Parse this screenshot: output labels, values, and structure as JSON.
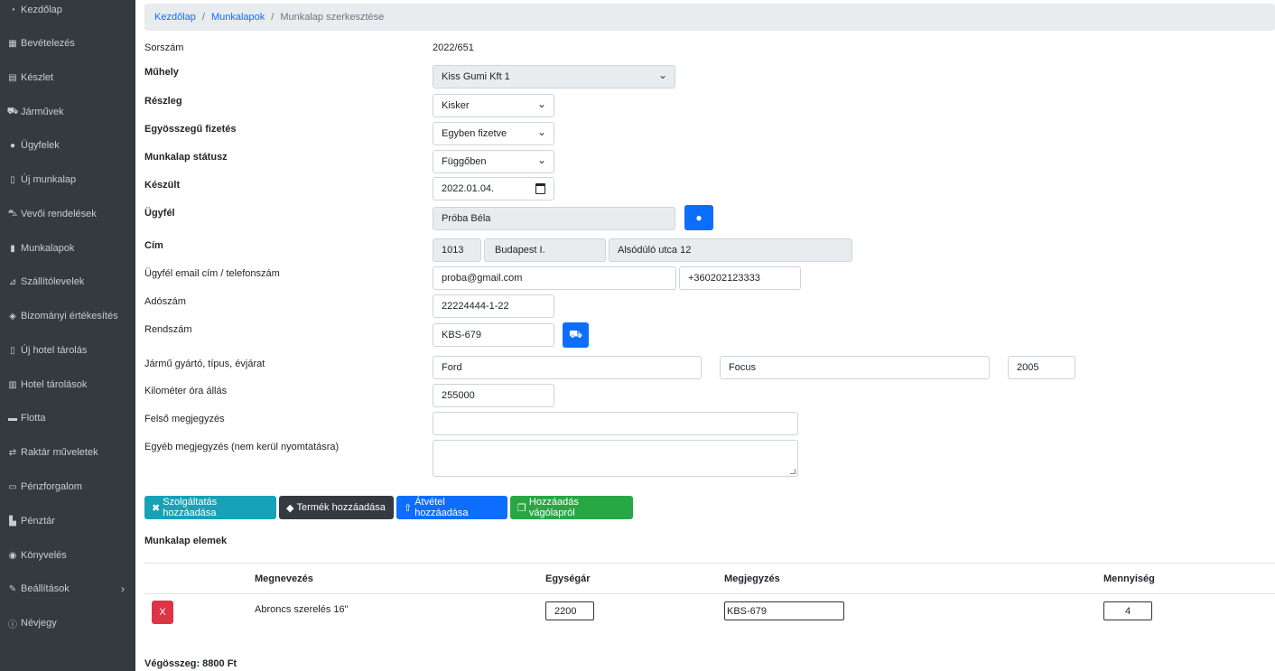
{
  "sidebar": {
    "items": [
      {
        "label": "Kezdőlap",
        "icon": "dashboard-icon"
      },
      {
        "label": "Bevételezés",
        "icon": "boxes-icon"
      },
      {
        "label": "Készlet",
        "icon": "warehouse-icon"
      },
      {
        "label": "Járművek",
        "icon": "car-icon"
      },
      {
        "label": "Ügyfelek",
        "icon": "user-icon"
      },
      {
        "label": "Új munkalap",
        "icon": "file-icon"
      },
      {
        "label": "Vevői rendelések",
        "icon": "cart-icon"
      },
      {
        "label": "Munkalapok",
        "icon": "file-icon"
      },
      {
        "label": "Szállítólevelek",
        "icon": "dolly-icon"
      },
      {
        "label": "Bizományi értékesítés",
        "icon": "handshake-icon"
      },
      {
        "label": "Új hotel tárolás",
        "icon": "file-icon"
      },
      {
        "label": "Hotel tárolások",
        "icon": "hotel-icon"
      },
      {
        "label": "Flotta",
        "icon": "fleet-icon"
      },
      {
        "label": "Raktár műveletek",
        "icon": "exchange-icon"
      },
      {
        "label": "Pénzforgalom",
        "icon": "money-icon"
      },
      {
        "label": "Pénztár",
        "icon": "cash-register-icon"
      },
      {
        "label": "Könyvelés",
        "icon": "comments-icon"
      },
      {
        "label": "Beállítások",
        "icon": "wrench-icon"
      },
      {
        "label": "Névjegy",
        "icon": "info-icon"
      }
    ]
  },
  "breadcrumb": {
    "home": "Kezdőlap",
    "list": "Munkalapok",
    "current": "Munkalap szerkesztése"
  },
  "form": {
    "sorszam_label": "Sorszám",
    "sorszam_value": "2022/651",
    "muhely_label": "Műhely",
    "muhely_value": "Kiss Gumi Kft 1",
    "reszleg_label": "Részleg",
    "reszleg_value": "Kisker",
    "fizetes_label": "Egyösszegű fizetés",
    "fizetes_value": "Egyben fizetve",
    "statusz_label": "Munkalap státusz",
    "statusz_value": "Függőben",
    "keszult_label": "Készült",
    "keszult_value": "2022.01.04.",
    "ugyfel_label": "Ügyfél",
    "ugyfel_value": "Próba Béla",
    "cim_label": "Cím",
    "cim_zip": "1013",
    "cim_city": "Budapest I.",
    "cim_street": "Alsódúló utca 12",
    "email_label": "Ügyfél email cím / telefonszám",
    "email_value": "proba@gmail.com",
    "phone_value": "+360202123333",
    "adoszam_label": "Adószám",
    "adoszam_value": "22224444-1-22",
    "rendszam_label": "Rendszám",
    "rendszam_value": "KBS-679",
    "jarmu_label": "Jármű gyártó, típus, évjárat",
    "jarmu_make": "Ford",
    "jarmu_model": "Focus",
    "jarmu_year": "2005",
    "km_label": "Kilométer óra állás",
    "km_value": "255000",
    "felso_label": "Felső megjegyzés",
    "felso_value": "",
    "egyeb_label": "Egyéb megjegyzés (nem kerül nyomtatásra)",
    "egyeb_value": ""
  },
  "actions": {
    "service": "Szolgáltatás hozzáadása",
    "product": "Termék hozzáadása",
    "takeover": "Átvétel hozzáadása",
    "clipboard": "Hozzáadás vágólapról"
  },
  "items": {
    "title": "Munkalap elemek",
    "headers": {
      "name": "Megnevezés",
      "price": "Egységár",
      "note": "Megjegyzés",
      "qty": "Mennyiség"
    },
    "rows": [
      {
        "delete": "X",
        "name": "Abroncs szerelés 16\"",
        "price": "2200",
        "note": "KBS-679",
        "qty": "4"
      }
    ]
  },
  "total": "Végösszeg: 8800 Ft",
  "colors": {
    "sidebar": "#343a40",
    "primary": "#0d6efd",
    "info": "#17a2b8",
    "dark": "#343a40",
    "success": "#28a745",
    "danger": "#dc3545"
  }
}
